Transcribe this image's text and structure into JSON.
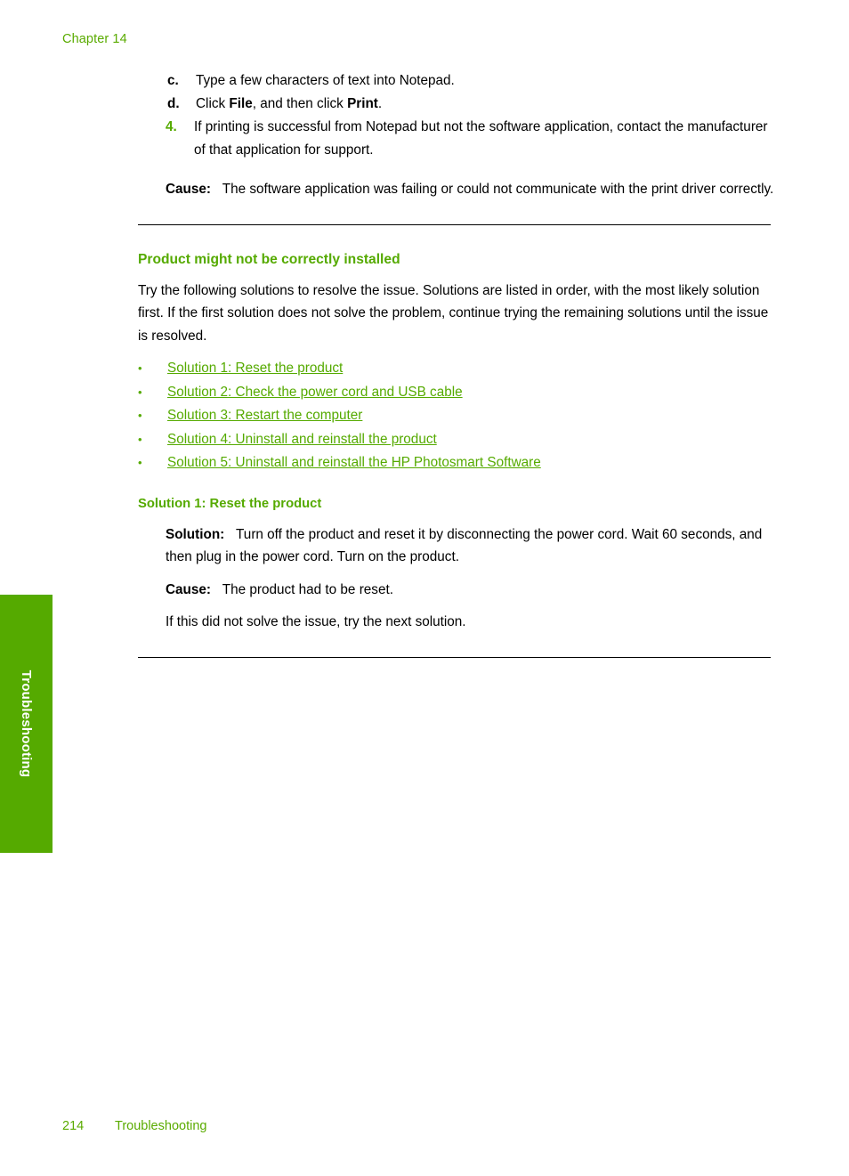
{
  "header": {
    "chapter": "Chapter 14"
  },
  "side_tab": {
    "label": "Troubleshooting"
  },
  "colors": {
    "accent_green": "#55aa00",
    "header_green": "#5aab00",
    "body_black": "#000000"
  },
  "content": {
    "steps": [
      {
        "marker": "c.",
        "text_before": "Type a few characters of text into Notepad.",
        "bold_1": "",
        "text_mid": "",
        "bold_2": "",
        "text_after": ""
      },
      {
        "marker": "d.",
        "text_before": "Click ",
        "bold_1": "File",
        "text_mid": ", and then click ",
        "bold_2": "Print",
        "text_after": "."
      }
    ],
    "main_step": {
      "marker": "4.",
      "text": "If printing is successful from Notepad but not the software application, contact the manufacturer of that application for support."
    },
    "cause_1": {
      "label": "Cause:",
      "text": "The software application was failing or could not communicate with the print driver correctly."
    },
    "section": {
      "heading": "Product might not be correctly installed",
      "intro": "Try the following solutions to resolve the issue. Solutions are listed in order, with the most likely solution first. If the first solution does not solve the problem, continue trying the remaining solutions until the issue is resolved.",
      "bullet_glyph": "•",
      "links": [
        "Solution 1: Reset the product",
        "Solution 2: Check the power cord and USB cable",
        "Solution 3: Restart the computer",
        "Solution 4: Uninstall and reinstall the product",
        "Solution 5: Uninstall and reinstall the HP Photosmart Software"
      ]
    },
    "solution_1": {
      "heading": "Solution 1: Reset the product",
      "solution_label": "Solution:",
      "solution_text": "Turn off the product and reset it by disconnecting the power cord. Wait 60 seconds, and then plug in the power cord. Turn on the product.",
      "cause_label": "Cause:",
      "cause_text": "The product had to be reset.",
      "next_text": "If this did not solve the issue, try the next solution."
    }
  },
  "footer": {
    "page_number": "214",
    "section_name": "Troubleshooting"
  }
}
